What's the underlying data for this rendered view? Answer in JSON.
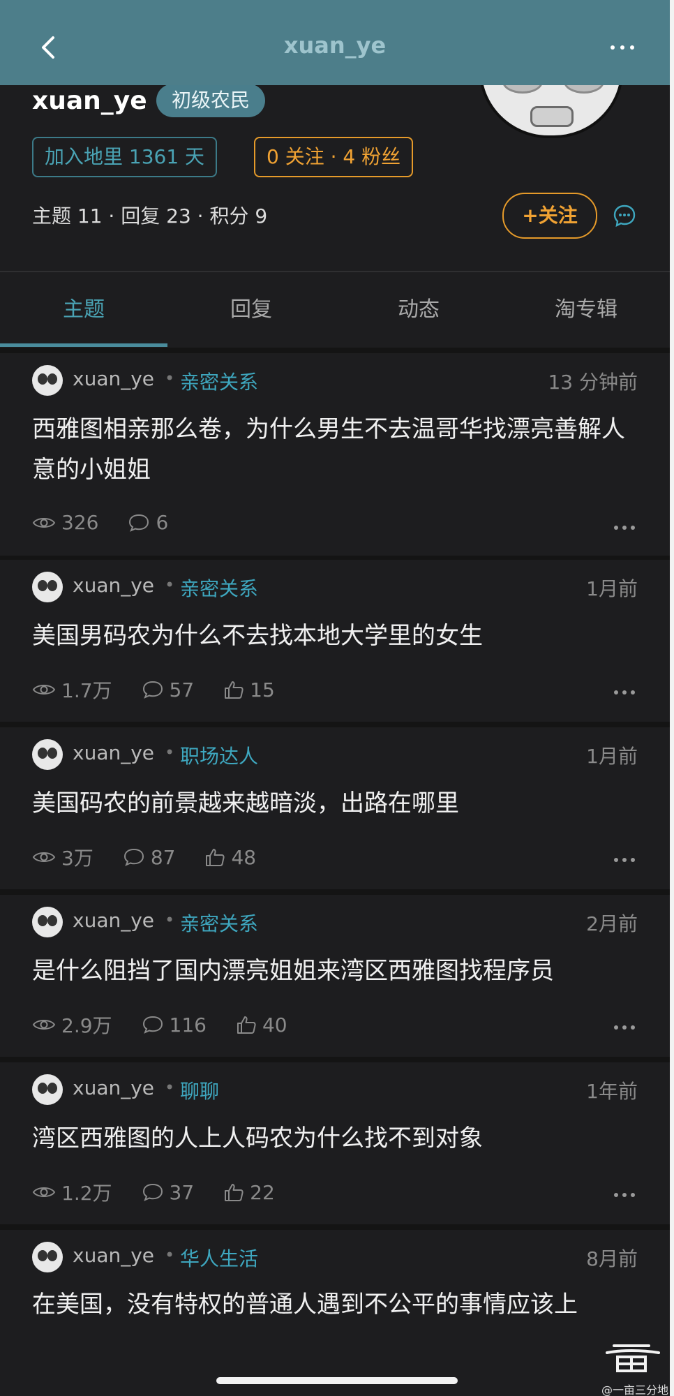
{
  "header": {
    "title": "xuan_ye"
  },
  "profile": {
    "username": "xuan_ye",
    "level": "初级农民",
    "join_text": "加入地里 1361 天",
    "follow_text": "0 关注 · 4 粉丝",
    "stats_text": "主题 11 · 回复 23 · 积分 9",
    "follow_button": "+关注"
  },
  "tabs": [
    {
      "label": "主题",
      "active": true
    },
    {
      "label": "回复",
      "active": false
    },
    {
      "label": "动态",
      "active": false
    },
    {
      "label": "淘专辑",
      "active": false
    }
  ],
  "posts": [
    {
      "author": "xuan_ye",
      "category": "亲密关系",
      "time": "13 分钟前",
      "title": "西雅图相亲那么卷，为什么男生不去温哥华找漂亮善解人意的小姐姐",
      "views": "326",
      "comments": "6",
      "likes": ""
    },
    {
      "author": "xuan_ye",
      "category": "亲密关系",
      "time": "1月前",
      "title": "美国男码农为什么不去找本地大学里的女生",
      "views": "1.7万",
      "comments": "57",
      "likes": "15"
    },
    {
      "author": "xuan_ye",
      "category": "职场达人",
      "time": "1月前",
      "title": "美国码农的前景越来越暗淡，出路在哪里",
      "views": "3万",
      "comments": "87",
      "likes": "48"
    },
    {
      "author": "xuan_ye",
      "category": "亲密关系",
      "time": "2月前",
      "title": "是什么阻挡了国内漂亮姐姐来湾区西雅图找程序员",
      "views": "2.9万",
      "comments": "116",
      "likes": "40"
    },
    {
      "author": "xuan_ye",
      "category": "聊聊",
      "time": "1年前",
      "title": "湾区西雅图的人上人码农为什么找不到对象",
      "views": "1.2万",
      "comments": "37",
      "likes": "22"
    },
    {
      "author": "xuan_ye",
      "category": "华人生活",
      "time": "8月前",
      "title": "在美国，没有特权的普通人遇到不公平的事情应该上",
      "views": "",
      "comments": "",
      "likes": ""
    }
  ],
  "watermark": "@一亩三分地",
  "colors": {
    "accent": "#4aa3b4",
    "orange": "#f0a233",
    "topbar": "#4d7e8a"
  }
}
